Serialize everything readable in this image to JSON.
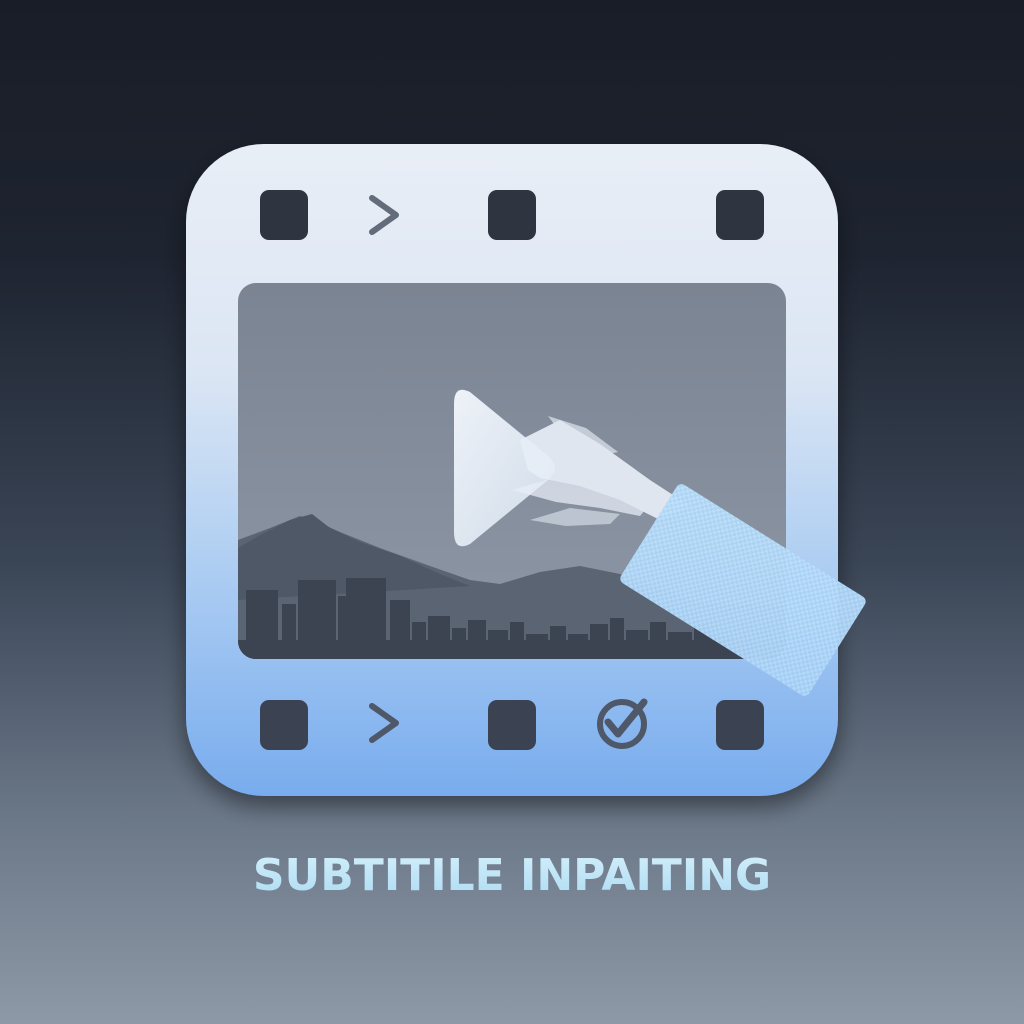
{
  "app": {
    "title": "SUBTITILE INPAITING"
  },
  "icon": {
    "name": "film-strip-icon",
    "center_symbol": "play-icon",
    "scene": "city-skyline-icon",
    "eraser": "subtitle-eraser-icon",
    "badge": "check-badge-icon"
  },
  "colors": {
    "background_top": "#191d27",
    "background_bottom": "#8e99a7",
    "frame_top": "#e8edf5",
    "frame_bottom": "#79aeef",
    "screen": "#7c8593",
    "sprocket": "#3a4250",
    "title": "#bfe6f7",
    "eraser": "#a9d3f5"
  }
}
